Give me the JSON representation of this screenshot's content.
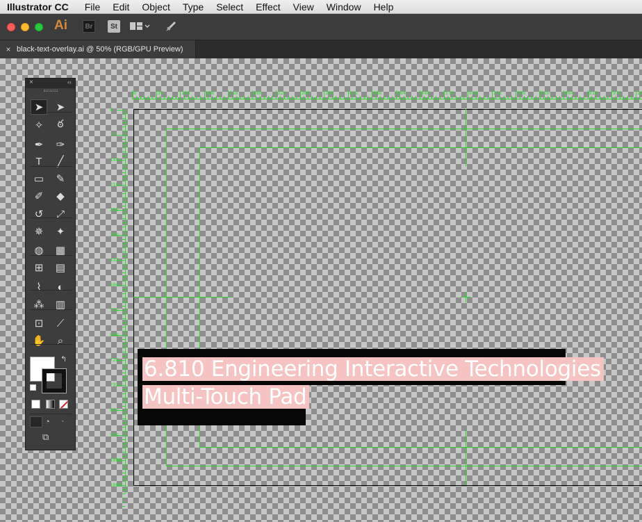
{
  "menubar": {
    "app_name": "Illustrator CC",
    "items": [
      "File",
      "Edit",
      "Object",
      "Type",
      "Select",
      "Effect",
      "View",
      "Window",
      "Help"
    ]
  },
  "appbar": {
    "logo": "Ai",
    "bridge_label": "Br",
    "stock_label": "St"
  },
  "document": {
    "tab_title": "black-text-overlay.ai @ 50% (RGB/GPU Preview)",
    "close_glyph": "×"
  },
  "rulers": {
    "top_labels": [
      "0",
      "36",
      "108",
      "180",
      "216",
      "288",
      "324",
      "360",
      "396",
      "432",
      "468",
      "504",
      "540",
      "576",
      "648",
      "702",
      "756",
      "810",
      "864",
      "918",
      "972",
      "1008"
    ],
    "left_labels": [
      "0",
      "72",
      "144",
      "216",
      "288",
      "360",
      "432",
      "504",
      "576",
      "648",
      "720",
      "792",
      "864",
      "936",
      "1008",
      "1080"
    ]
  },
  "artwork": {
    "line1": "6.810 Engineering Interactive Technologies",
    "line2": "Multi-Touch Pad"
  },
  "colors": {
    "guide": "#2fd52f",
    "highlight": "#f6c3c3",
    "text_box": "#070707"
  },
  "tools": [
    "selection-tool",
    "direct-selection-tool",
    "magic-wand-tool",
    "lasso-tool",
    "pen-tool",
    "curvature-tool",
    "type-tool",
    "line-segment-tool",
    "rectangle-tool",
    "paintbrush-tool",
    "shaper-tool",
    "eraser-tool",
    "rotate-tool",
    "scale-tool",
    "puppet-warp-tool",
    "pin-tool",
    "shape-builder-tool",
    "perspective-grid-tool",
    "mesh-tool",
    "gradient-tool",
    "eyedropper-tool",
    "blend-tool",
    "symbol-sprayer-tool",
    "column-graph-tool",
    "artboard-tool",
    "slice-tool",
    "hand-tool",
    "zoom-tool"
  ]
}
